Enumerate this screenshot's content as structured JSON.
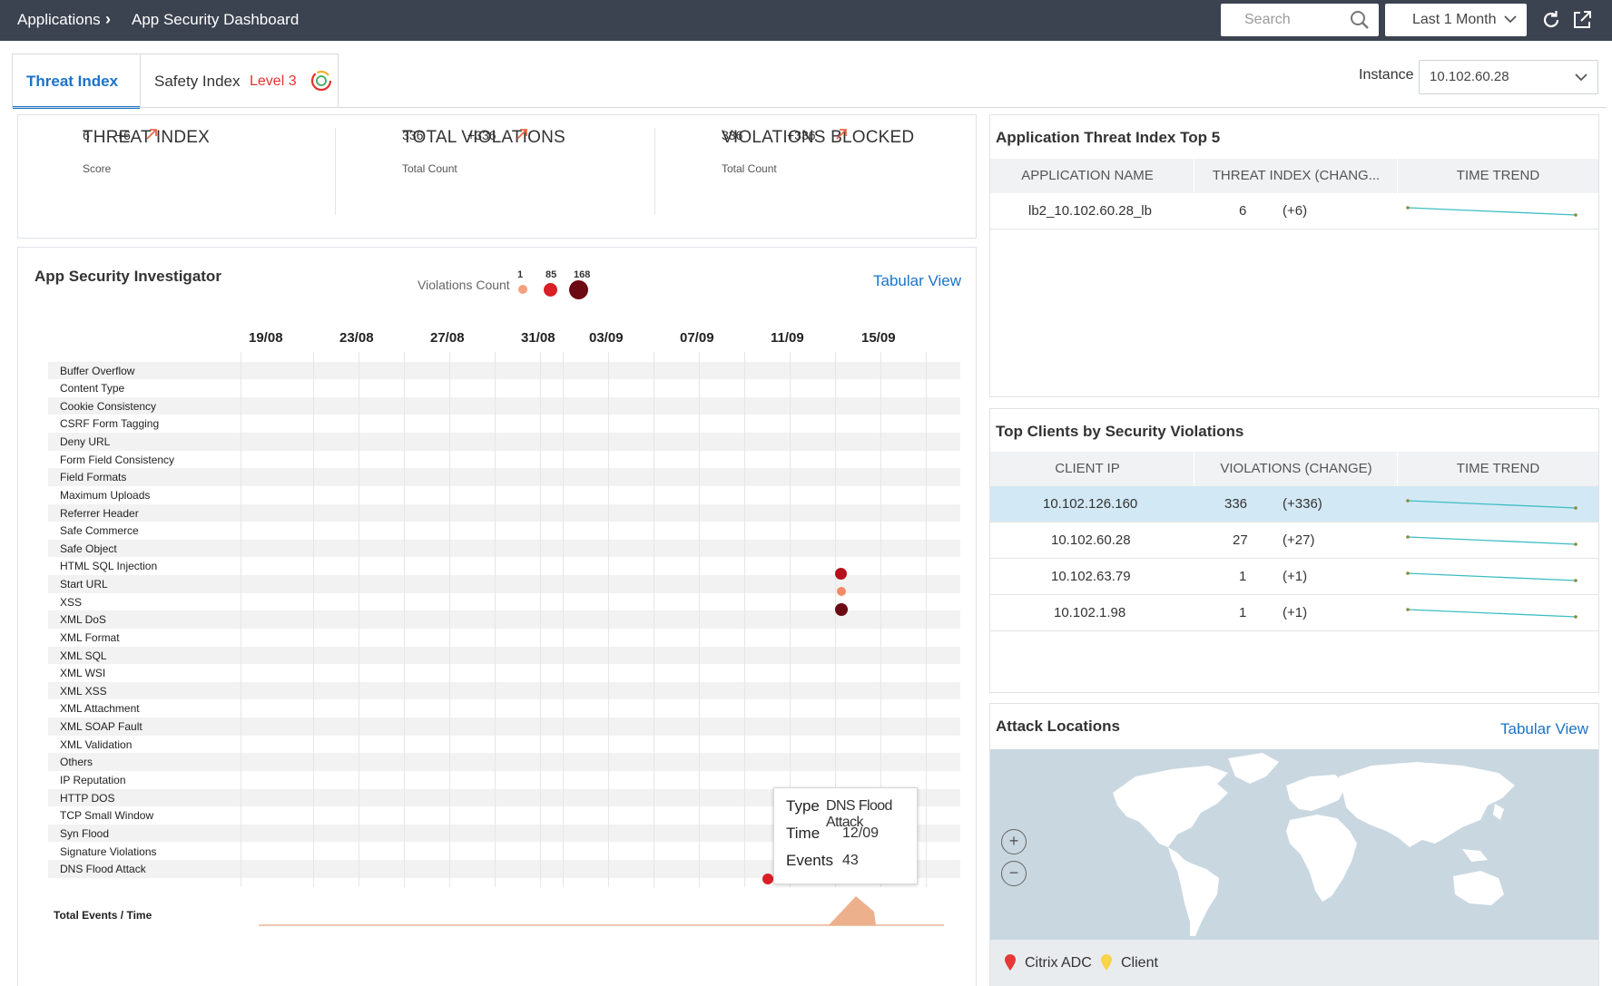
{
  "breadcrumb": {
    "parent": "Applications",
    "current": "App Security Dashboard"
  },
  "search": {
    "placeholder": "Search"
  },
  "time_range": {
    "value": "Last 1 Month"
  },
  "tabs": [
    {
      "label": "Threat Index",
      "active": true
    },
    {
      "label": "Safety Index",
      "badge": "Level 3"
    }
  ],
  "instance": {
    "label": "Instance",
    "value": "10.102.60.28"
  },
  "kpis": [
    {
      "title": "THREAT INDEX",
      "subtitle": "Score",
      "value": "6",
      "change": "+6"
    },
    {
      "title": "TOTAL VIOLATIONS",
      "subtitle": "Total Count",
      "value": "336",
      "change": "+336"
    },
    {
      "title": "VIOLATIONS BLOCKED",
      "subtitle": "Total Count",
      "value": "336",
      "change": "+336"
    }
  ],
  "investigator": {
    "title": "App Security Investigator",
    "legend_label": "Violations Count",
    "legend_values": [
      "1",
      "85",
      "168"
    ],
    "tabular_link": "Tabular View",
    "dates": [
      "19/08",
      "23/08",
      "27/08",
      "31/08",
      "03/09",
      "07/09",
      "11/09",
      "15/09"
    ],
    "violation_types": [
      "Buffer Overflow",
      "Content Type",
      "Cookie Consistency",
      "CSRF Form Tagging",
      "Deny URL",
      "Form Field Consistency",
      "Field Formats",
      "Maximum Uploads",
      "Referrer Header",
      "Safe Commerce",
      "Safe Object",
      "HTML SQL Injection",
      "Start URL",
      "XSS",
      "XML DoS",
      "XML Format",
      "XML SQL",
      "XML WSI",
      "XML XSS",
      "XML Attachment",
      "XML SOAP Fault",
      "XML Validation",
      "Others",
      "IP Reputation",
      "HTTP DOS",
      "TCP Small Window",
      "Syn Flood",
      "Signature Violations",
      "DNS Flood Attack"
    ],
    "total_label": "Total Events / Time",
    "tooltip": {
      "type_label": "Type",
      "type_value": "DNS Flood Attack",
      "time_label": "Time",
      "time_value": "12/09",
      "events_label": "Events",
      "events_value": "43"
    }
  },
  "threat_top5": {
    "title": "Application Threat Index Top 5",
    "columns": [
      "APPLICATION NAME",
      "THREAT INDEX (CHANG...",
      "TIME TREND"
    ],
    "rows": [
      {
        "name": "lb2_10.102.60.28_lb",
        "value": "6",
        "change": "(+6)"
      }
    ]
  },
  "top_clients": {
    "title": "Top Clients by Security Violations",
    "columns": [
      "CLIENT IP",
      "VIOLATIONS (CHANGE)",
      "TIME TREND"
    ],
    "rows": [
      {
        "ip": "10.102.126.160",
        "value": "336",
        "change": "(+336)"
      },
      {
        "ip": "10.102.60.28",
        "value": "27",
        "change": "(+27)"
      },
      {
        "ip": "10.102.63.79",
        "value": "1",
        "change": "(+1)"
      },
      {
        "ip": "10.102.1.98",
        "value": "1",
        "change": "(+1)"
      }
    ]
  },
  "attack_locations": {
    "title": "Attack Locations",
    "tabular_link": "Tabular View",
    "legend": [
      "Citrix ADC",
      "Client"
    ]
  },
  "colors": {
    "accent": "#1a73c9",
    "kpi": "#e8684a",
    "dot_low": "#f5a07e",
    "dot_mid": "#d81f26",
    "dot_high": "#6b0a12",
    "trend": "#3dbdc4"
  }
}
